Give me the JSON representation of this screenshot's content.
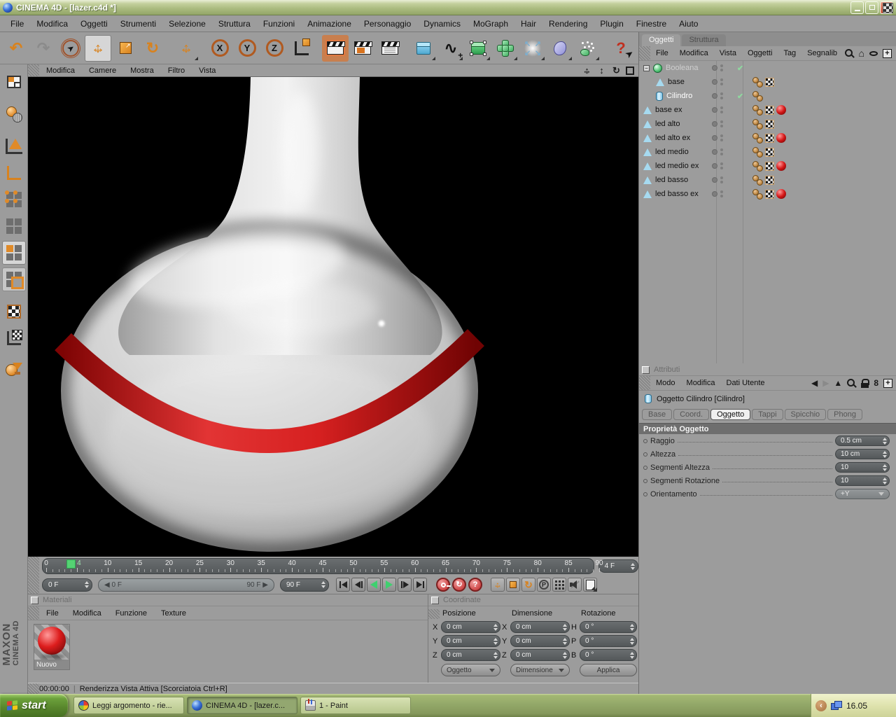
{
  "window": {
    "title": "CINEMA 4D - [lazer.c4d *]"
  },
  "menubar": {
    "items": [
      "File",
      "Modifica",
      "Oggetti",
      "Strumenti",
      "Selezione",
      "Struttura",
      "Funzioni",
      "Animazione",
      "Personaggio",
      "Dynamics",
      "MoGraph",
      "Hair",
      "Rendering",
      "Plugin",
      "Finestre",
      "Aiuto"
    ]
  },
  "viewport_menu": {
    "items": [
      "Modifica",
      "Camere",
      "Mostra",
      "Filtro",
      "Vista"
    ]
  },
  "icons": {
    "undo": "↶",
    "redo": "↷",
    "rotate": "↻",
    "cursor": "➤",
    "arrow_h": "↔",
    "arrow_v": "↕",
    "diag": "↗",
    "x": "X",
    "y": "Y",
    "z": "Z",
    "p": "P",
    "spline": "∿",
    "plus": "+",
    "minus": "−",
    "nw": "↖",
    "ne": "↗",
    "se": "↘",
    "sw": "↙",
    "back": "◀",
    "forward": "▶",
    "up": "▲",
    "home": "⌂",
    "link": "8",
    "question": "?",
    "close": "×",
    "chevron_left": "‹",
    "expander_minus": "−",
    "check": "✔",
    "slider_left": "◀",
    "slider_right": "▶"
  },
  "timeline": {
    "start": 0,
    "end": 90,
    "label_step": 5,
    "current": 4,
    "current_label": "4",
    "current_field": "4 F",
    "range_start_field": "0 F",
    "range_end_field": "90 F",
    "slider_start": "0 F",
    "slider_end": "90 F"
  },
  "materials": {
    "title": "Materiali",
    "menu": [
      "File",
      "Modifica",
      "Funzione",
      "Texture"
    ],
    "items": [
      {
        "name": "Nuovo"
      }
    ]
  },
  "coordinates": {
    "title": "Coordinate",
    "columns": [
      "Posizione",
      "Dimensione",
      "Rotazione"
    ],
    "position": {
      "X": "0 cm",
      "Y": "0 cm",
      "Z": "0 cm"
    },
    "dimension": {
      "X": "0 cm",
      "Y": "0 cm",
      "Z": "0 cm"
    },
    "rotation": {
      "H": "0 °",
      "P": "0 °",
      "B": "0 °"
    },
    "axis_labels": {
      "pos": [
        "X",
        "Y",
        "Z"
      ],
      "dim": [
        "X",
        "Y",
        "Z"
      ],
      "rot": [
        "H",
        "P",
        "B"
      ]
    },
    "buttons": {
      "mode_left": "Oggetto",
      "mode_center": "Dimensione",
      "apply": "Applica"
    }
  },
  "object_manager": {
    "tabs": [
      "Oggetti",
      "Struttura"
    ],
    "active_tab": "Oggetti",
    "menu": [
      "File",
      "Modifica",
      "Vista",
      "Oggetti",
      "Tag",
      "Segnalib"
    ],
    "items": [
      {
        "name": "Booleana",
        "depth": 0,
        "icon": "boolean",
        "expander": true,
        "check": true,
        "dim": true,
        "selected": false,
        "tags": []
      },
      {
        "name": "base",
        "depth": 1,
        "icon": "cone",
        "expander": false,
        "check": false,
        "dim": false,
        "selected": false,
        "tags": [
          "balls",
          "checker"
        ]
      },
      {
        "name": "Cilindro",
        "depth": 1,
        "icon": "cylinder",
        "expander": false,
        "check": true,
        "dim": false,
        "selected": true,
        "tags": [
          "balls"
        ]
      },
      {
        "name": "base ex",
        "depth": 0,
        "icon": "cone",
        "expander": false,
        "check": false,
        "dim": false,
        "selected": false,
        "tags": [
          "balls",
          "checker",
          "material"
        ]
      },
      {
        "name": "led alto",
        "depth": 0,
        "icon": "cone",
        "expander": false,
        "check": false,
        "dim": false,
        "selected": false,
        "tags": [
          "balls",
          "checker"
        ]
      },
      {
        "name": "led alto ex",
        "depth": 0,
        "icon": "cone",
        "expander": false,
        "check": false,
        "dim": false,
        "selected": false,
        "tags": [
          "balls",
          "checker",
          "material"
        ]
      },
      {
        "name": "led medio",
        "depth": 0,
        "icon": "cone",
        "expander": false,
        "check": false,
        "dim": false,
        "selected": false,
        "tags": [
          "balls",
          "checker"
        ]
      },
      {
        "name": "led medio ex",
        "depth": 0,
        "icon": "cone",
        "expander": false,
        "check": false,
        "dim": false,
        "selected": false,
        "tags": [
          "balls",
          "checker",
          "material"
        ]
      },
      {
        "name": "led basso",
        "depth": 0,
        "icon": "cone",
        "expander": false,
        "check": false,
        "dim": false,
        "selected": false,
        "tags": [
          "balls",
          "checker"
        ]
      },
      {
        "name": "led basso ex",
        "depth": 0,
        "icon": "cone",
        "expander": false,
        "check": false,
        "dim": false,
        "selected": false,
        "tags": [
          "balls",
          "checker",
          "material"
        ]
      }
    ]
  },
  "attributes": {
    "title": "Attributi",
    "menu": [
      "Modo",
      "Modifica",
      "Dati Utente"
    ],
    "object_header": "Oggetto Cilindro [Cilindro]",
    "tabs": [
      "Base",
      "Coord.",
      "Oggetto",
      "Tappi",
      "Spicchio",
      "Phong"
    ],
    "active_tab": "Oggetto",
    "section": "Proprietà Oggetto",
    "props": [
      {
        "label": "Raggio",
        "value": "0.5 cm",
        "type": "spinner"
      },
      {
        "label": "Altezza",
        "value": "10 cm",
        "type": "spinner"
      },
      {
        "label": "Segmenti Altezza",
        "value": "10",
        "type": "spinner"
      },
      {
        "label": "Segmenti Rotazione",
        "value": "10",
        "type": "spinner"
      },
      {
        "label": "Orientamento",
        "value": "+Y",
        "type": "dropdown"
      }
    ]
  },
  "statusbar": {
    "time": "00:00:00",
    "message": "Renderizza Vista Attiva [Scorciatoia Ctrl+R]"
  },
  "branding": {
    "line1": "MAXON",
    "line2": "CINEMA 4D"
  },
  "taskbar": {
    "start": "start",
    "tasks": [
      {
        "label": "Leggi argomento - rie...",
        "icon": "browser",
        "active": false
      },
      {
        "label": "CINEMA 4D - [lazer.c...",
        "icon": "c4d",
        "active": true
      },
      {
        "label": "1 - Paint",
        "icon": "paint",
        "active": false
      }
    ],
    "tray_time": "16.05"
  },
  "colors": {
    "accent_orange": "#d8821e",
    "playhead_green": "#55d273",
    "material_red": "#d41616",
    "titlebar_green": "#a9ba7e",
    "taskbar_green": "#93a869",
    "viewport_bg": "#000000"
  }
}
